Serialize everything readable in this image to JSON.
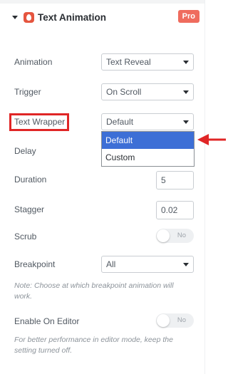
{
  "section": {
    "title": "Text Animation",
    "badge": "Pro",
    "brand_color": "#e5553f",
    "badge_color": "#ef6c5e"
  },
  "fields": {
    "animation": {
      "label": "Animation",
      "value": "Text Reveal"
    },
    "trigger": {
      "label": "Trigger",
      "value": "On Scroll"
    },
    "text_wrapper": {
      "label": "Text Wrapper",
      "value": "Default"
    },
    "delay": {
      "label": "Delay"
    },
    "duration": {
      "label": "Duration",
      "value": "5"
    },
    "stagger": {
      "label": "Stagger",
      "value": "0.02"
    },
    "scrub": {
      "label": "Scrub",
      "toggle_text": "No"
    },
    "breakpoint": {
      "label": "Breakpoint",
      "value": "All"
    },
    "breakpoint_note": "Note: Choose at which breakpoint animation will work.",
    "enable_on_editor": {
      "label": "Enable On Editor",
      "toggle_text": "No"
    },
    "editor_note": "For better performance in editor mode, keep the setting turned off."
  },
  "dropdown": {
    "options": [
      "Default",
      "Custom"
    ],
    "selected": "Default",
    "highlight_color": "#3d6fd6"
  },
  "annotation": {
    "color": "#e02626"
  }
}
